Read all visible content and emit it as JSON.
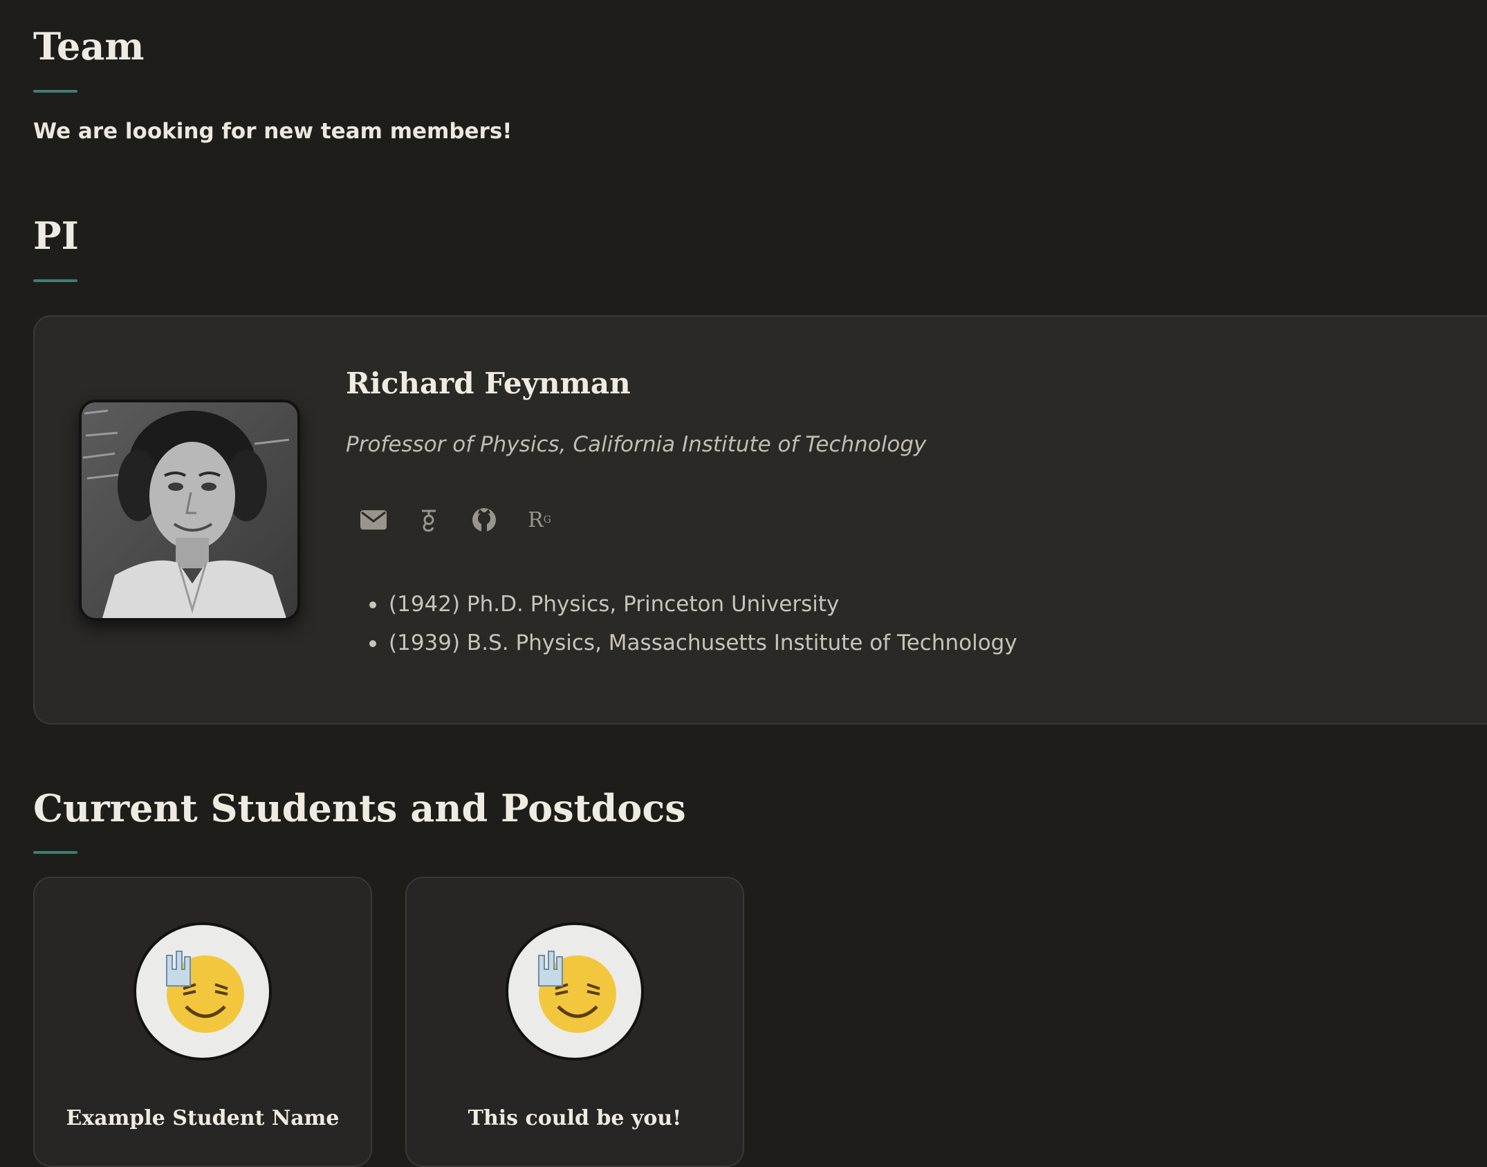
{
  "team": {
    "heading": "Team",
    "intro": "We are looking for new team members!"
  },
  "pi_section": {
    "heading": "PI",
    "name": "Richard Feynman",
    "title": "Professor of Physics, California Institute of Technology",
    "links": {
      "email": "email-icon",
      "scholar": "google-scholar-icon",
      "github": "github-icon",
      "researchgate_label": "R",
      "researchgate_sup": "G"
    },
    "education": [
      "(1942) Ph.D. Physics, Princeton University",
      "(1939) B.S. Physics, Massachusetts Institute of Technology"
    ]
  },
  "students_section": {
    "heading": "Current Students and Postdocs",
    "members": [
      {
        "name": "Example Student Name",
        "avatar": "rock-on-emoji"
      },
      {
        "name": "This could be you!",
        "avatar": "rock-on-emoji"
      }
    ]
  },
  "colors": {
    "background": "#1e1d1a",
    "card": "#2a2926",
    "accent": "#3e7f74",
    "text": "#efebe2",
    "muted": "#c2bdb3"
  }
}
